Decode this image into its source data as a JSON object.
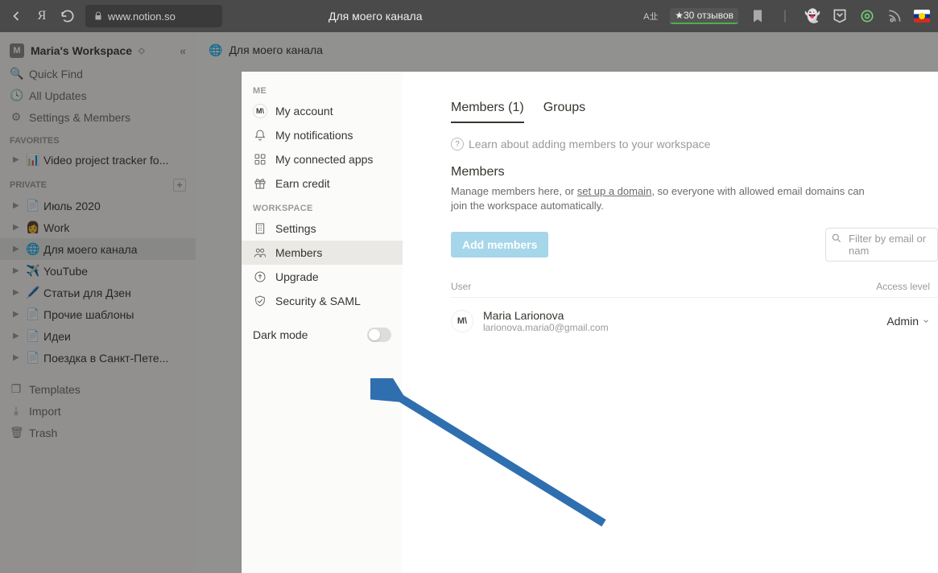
{
  "browser": {
    "url": "www.notion.so",
    "tab_title": "Для моего канала",
    "reviews": "★30 отзывов"
  },
  "sidebar": {
    "workspace": "Maria's Workspace",
    "quick_find": "Quick Find",
    "all_updates": "All Updates",
    "settings_members": "Settings & Members",
    "favorites_label": "FAVORITES",
    "favorites": [
      {
        "icon": "📊",
        "label": "Video project tracker fo..."
      }
    ],
    "private_label": "PRIVATE",
    "private": [
      {
        "icon": "📄",
        "label": "Июль 2020"
      },
      {
        "icon": "👩",
        "label": "Work"
      },
      {
        "icon": "🌐",
        "label": "Для моего канала",
        "active": true
      },
      {
        "icon": "✈️",
        "label": "YouTube"
      },
      {
        "icon": "🖊️",
        "label": "Статьи для Дзен"
      },
      {
        "icon": "📄",
        "label": "Прочие шаблоны"
      },
      {
        "icon": "📄",
        "label": "Идеи"
      },
      {
        "icon": "📄",
        "label": "Поездка в Санкт-Пете..."
      }
    ],
    "templates": "Templates",
    "import": "Import",
    "trash": "Trash"
  },
  "breadcrumb": {
    "icon": "🌐",
    "label": "Для моего канала"
  },
  "settings": {
    "me_label": "ME",
    "me": [
      {
        "label": "My account",
        "icon": "avatar"
      },
      {
        "label": "My notifications",
        "icon": "bell"
      },
      {
        "label": "My connected apps",
        "icon": "grid"
      },
      {
        "label": "Earn credit",
        "icon": "gift"
      }
    ],
    "ws_label": "WORKSPACE",
    "ws": [
      {
        "label": "Settings",
        "icon": "building"
      },
      {
        "label": "Members",
        "icon": "people",
        "selected": true
      },
      {
        "label": "Upgrade",
        "icon": "up"
      },
      {
        "label": "Security & SAML",
        "icon": "shield"
      }
    ],
    "dark_mode": "Dark mode"
  },
  "content": {
    "tab_members": "Members (1)",
    "tab_groups": "Groups",
    "hint": "Learn about adding members to your workspace",
    "heading": "Members",
    "desc_pre": "Manage members here, or ",
    "desc_link": "set up a domain",
    "desc_post": ", so everyone with allowed email domains can join the workspace automatically.",
    "add_btn": "Add members",
    "filter_placeholder": "Filter by email or nam",
    "col_user": "User",
    "col_access": "Access level",
    "member": {
      "avatar": "M\\",
      "name": "Maria Larionova",
      "email": "larionova.maria0@gmail.com",
      "access": "Admin"
    }
  }
}
